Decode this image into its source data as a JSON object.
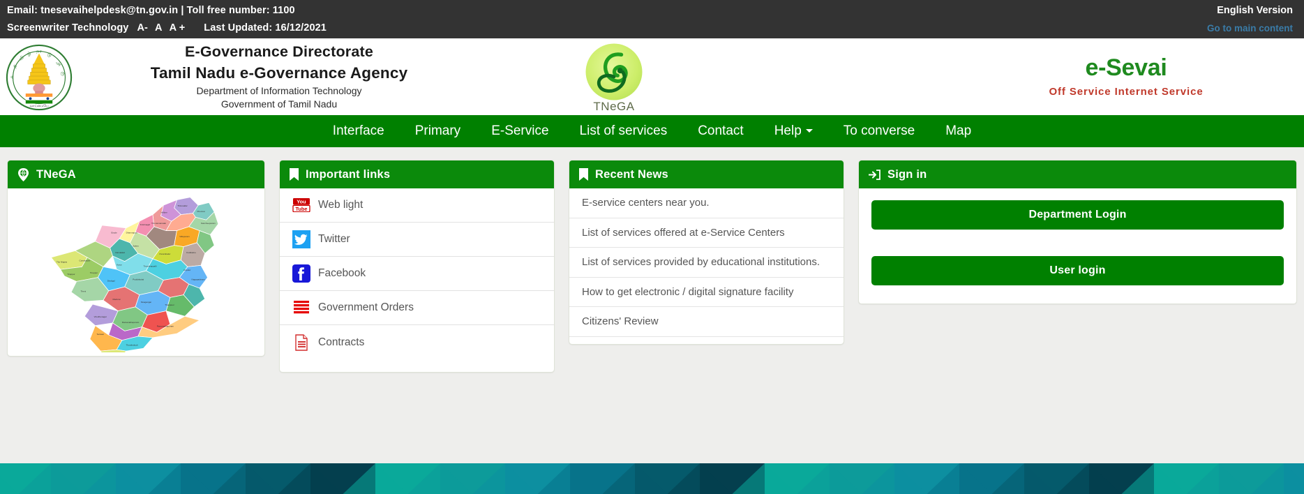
{
  "topbar": {
    "contact_line": "Email: tnesevaihelpdesk@tn.gov.in | Toll free number: 1100",
    "screenreader_label": "Screenwriter Technology",
    "font_decrease": "A-",
    "font_normal": "A",
    "font_increase": "A +",
    "last_updated": "Last Updated: 16/12/2021",
    "language_version": "English Version",
    "skip_link": "Go to main content"
  },
  "masthead": {
    "title_line1": "E-Governance Directorate",
    "title_line2": "Tamil Nadu e-Governance Agency",
    "title_line3": "Department of Information Technology",
    "title_line4": "Government of Tamil Nadu",
    "tnega_caption": "TNeGA",
    "brand_main": "e-Sevai",
    "brand_sub": "Off Service Internet Service",
    "emblem_alt": "Government of Tamil Nadu emblem"
  },
  "nav": {
    "items": [
      {
        "label": "Interface",
        "has_caret": false
      },
      {
        "label": "Primary",
        "has_caret": false
      },
      {
        "label": "E-Service",
        "has_caret": false
      },
      {
        "label": "List of services",
        "has_caret": false
      },
      {
        "label": "Contact",
        "has_caret": false
      },
      {
        "label": "Help",
        "has_caret": true
      },
      {
        "label": "To converse",
        "has_caret": false
      },
      {
        "label": "Map",
        "has_caret": false
      }
    ]
  },
  "cards": {
    "tnega": {
      "title": "TNeGA",
      "icon": "globe-marker-icon",
      "map_alt": "Tamil Nadu district map"
    },
    "important_links": {
      "title": "Important links",
      "icon": "bookmark-icon",
      "items": [
        {
          "label": "Web light",
          "icon": "youtube-icon"
        },
        {
          "label": "Twitter",
          "icon": "twitter-icon"
        },
        {
          "label": "Facebook",
          "icon": "facebook-icon"
        },
        {
          "label": "Government Orders",
          "icon": "government-orders-icon"
        },
        {
          "label": "Contracts",
          "icon": "contracts-document-icon"
        }
      ]
    },
    "recent_news": {
      "title": "Recent News",
      "icon": "bookmark-icon",
      "items": [
        {
          "label": "E-service centers near you."
        },
        {
          "label": "List of services offered at e-Service Centers"
        },
        {
          "label": "List of services provided by educational institutions."
        },
        {
          "label": "How to get electronic / digital signature facility"
        },
        {
          "label": "Citizens' Review"
        }
      ]
    },
    "sign_in": {
      "title": "Sign in",
      "icon": "sign-in-arrow-icon",
      "department_login": "Department Login",
      "user_login": "User login"
    }
  },
  "colors": {
    "topbar_bg": "#333333",
    "nav_green": "#008000",
    "card_head_green": "#0b8a0b",
    "brand_green": "#1f8a1f",
    "brand_red": "#c0392b",
    "link_blue": "#3a7ca8",
    "page_bg": "#eeeeec",
    "footer_teal_light": "#0aa99a",
    "footer_teal_mid": "#0d8fa0",
    "footer_teal_dark": "#055a6b",
    "footer_navy": "#043f4e"
  }
}
